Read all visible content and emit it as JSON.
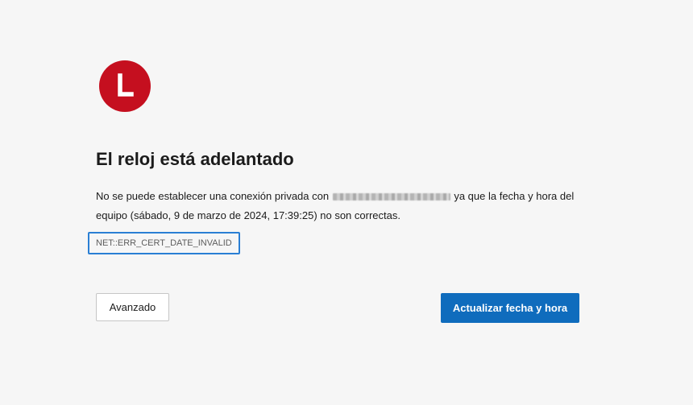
{
  "colors": {
    "background": "#f6f6f6",
    "icon_red": "#c50f1f",
    "primary_button": "#0f6cbd",
    "focus_outline": "#2a7fd4",
    "error_code_text": "#5c5c5c"
  },
  "icon": {
    "name": "clock-warning-icon"
  },
  "error": {
    "title": "El reloj está adelantado",
    "message_before": "No se puede establecer una conexión privada con",
    "message_after": "ya que la fecha y hora del equipo (sábado, 9 de marzo de 2024, 17:39:25) no son correctas.",
    "code": "NET::ERR_CERT_DATE_INVALID"
  },
  "buttons": {
    "advanced": "Avanzado",
    "update_datetime": "Actualizar fecha y hora"
  }
}
